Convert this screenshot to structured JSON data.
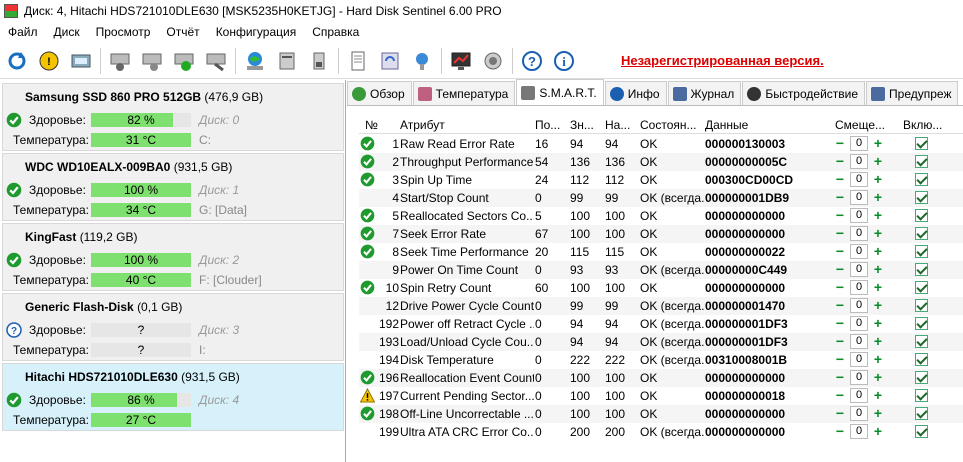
{
  "window": {
    "title": "Диск: 4, Hitachi HDS721010DLE630 [MSK5235H0KETJG]  -  Hard Disk Sentinel 6.00 PRO"
  },
  "menu": [
    "Файл",
    "Диск",
    "Просмотр",
    "Отчёт",
    "Конфигурация",
    "Справка"
  ],
  "toolbar": {
    "unregistered": "Незарегистрированная версия."
  },
  "disks": [
    {
      "name": "Samsung SSD 860 PRO 512GB",
      "size": "(476,9 GB)",
      "health_label": "Здоровье:",
      "health": "82 %",
      "health_pct": 82,
      "disk_label": "Диск: 0",
      "temp_label": "Температура:",
      "temp": "31 °C",
      "drive": "C:",
      "status": "ok"
    },
    {
      "name": "WDC WD10EALX-009BA0",
      "size": "(931,5 GB)",
      "health_label": "Здоровье:",
      "health": "100 %",
      "health_pct": 100,
      "disk_label": "Диск: 1",
      "temp_label": "Температура:",
      "temp": "34 °C",
      "drive": "G: [Data]",
      "status": "ok"
    },
    {
      "name": "KingFast",
      "size": "(119,2 GB)",
      "health_label": "Здоровье:",
      "health": "100 %",
      "health_pct": 100,
      "disk_label": "Диск: 2",
      "temp_label": "Температура:",
      "temp": "40 °C",
      "drive": "F: [Clouder]",
      "status": "ok"
    },
    {
      "name": "Generic Flash-Disk",
      "size": "(0,1 GB)",
      "health_label": "Здоровье:",
      "health": "?",
      "health_pct": 0,
      "disk_label": "Диск: 3",
      "temp_label": "Температура:",
      "temp": "?",
      "drive": "I:",
      "status": "unknown"
    },
    {
      "name": "Hitachi HDS721010DLE630",
      "size": "(931,5 GB)",
      "health_label": "Здоровье:",
      "health": "86 %",
      "health_pct": 86,
      "disk_label": "Диск: 4",
      "temp_label": "Температура:",
      "temp": "27 °C",
      "drive": "",
      "status": "ok"
    }
  ],
  "tabs": [
    "Обзор",
    "Температура",
    "S.M.A.R.T.",
    "Инфо",
    "Журнал",
    "Быстродействие",
    "Предупреж"
  ],
  "smart": {
    "headers": [
      "№",
      "Атрибут",
      "По...",
      "Зн...",
      "На...",
      "Состоян...",
      "Данные",
      "Смеще...",
      "Вклю..."
    ],
    "rows": [
      {
        "st": "ok",
        "n": "1",
        "attr": "Raw Read Error Rate",
        "p": "16",
        "z": "94",
        "na": "94",
        "s": "OK",
        "d": "000000130003",
        "off": "0"
      },
      {
        "st": "ok",
        "n": "2",
        "attr": "Throughput Performance",
        "p": "54",
        "z": "136",
        "na": "136",
        "s": "OK",
        "d": "00000000005C",
        "off": "0"
      },
      {
        "st": "ok",
        "n": "3",
        "attr": "Spin Up Time",
        "p": "24",
        "z": "112",
        "na": "112",
        "s": "OK",
        "d": "000300CD00CD",
        "off": "0"
      },
      {
        "st": "",
        "n": "4",
        "attr": "Start/Stop Count",
        "p": "0",
        "z": "99",
        "na": "99",
        "s": "OK (всегда...",
        "d": "000000001DB9",
        "off": "0"
      },
      {
        "st": "ok",
        "n": "5",
        "attr": "Reallocated Sectors Co...",
        "p": "5",
        "z": "100",
        "na": "100",
        "s": "OK",
        "d": "000000000000",
        "off": "0"
      },
      {
        "st": "ok",
        "n": "7",
        "attr": "Seek Error Rate",
        "p": "67",
        "z": "100",
        "na": "100",
        "s": "OK",
        "d": "000000000000",
        "off": "0"
      },
      {
        "st": "ok",
        "n": "8",
        "attr": "Seek Time Performance",
        "p": "20",
        "z": "115",
        "na": "115",
        "s": "OK",
        "d": "000000000022",
        "off": "0"
      },
      {
        "st": "",
        "n": "9",
        "attr": "Power On Time Count",
        "p": "0",
        "z": "93",
        "na": "93",
        "s": "OK (всегда...",
        "d": "00000000C449",
        "off": "0"
      },
      {
        "st": "ok",
        "n": "10",
        "attr": "Spin Retry Count",
        "p": "60",
        "z": "100",
        "na": "100",
        "s": "OK",
        "d": "000000000000",
        "off": "0"
      },
      {
        "st": "",
        "n": "12",
        "attr": "Drive Power Cycle Count",
        "p": "0",
        "z": "99",
        "na": "99",
        "s": "OK (всегда...",
        "d": "000000001470",
        "off": "0"
      },
      {
        "st": "",
        "n": "192",
        "attr": "Power off Retract Cycle ...",
        "p": "0",
        "z": "94",
        "na": "94",
        "s": "OK (всегда...",
        "d": "000000001DF3",
        "off": "0"
      },
      {
        "st": "",
        "n": "193",
        "attr": "Load/Unload Cycle Cou...",
        "p": "0",
        "z": "94",
        "na": "94",
        "s": "OK (всегда...",
        "d": "000000001DF3",
        "off": "0"
      },
      {
        "st": "",
        "n": "194",
        "attr": "Disk Temperature",
        "p": "0",
        "z": "222",
        "na": "222",
        "s": "OK (всегда...",
        "d": "00310008001B",
        "off": "0"
      },
      {
        "st": "ok",
        "n": "196",
        "attr": "Reallocation Event Count",
        "p": "0",
        "z": "100",
        "na": "100",
        "s": "OK",
        "d": "000000000000",
        "off": "0"
      },
      {
        "st": "warn",
        "n": "197",
        "attr": "Current Pending Sector...",
        "p": "0",
        "z": "100",
        "na": "100",
        "s": "OK",
        "d": "000000000018",
        "off": "0"
      },
      {
        "st": "ok",
        "n": "198",
        "attr": "Off-Line Uncorrectable ...",
        "p": "0",
        "z": "100",
        "na": "100",
        "s": "OK",
        "d": "000000000000",
        "off": "0"
      },
      {
        "st": "",
        "n": "199",
        "attr": "Ultra ATA CRC Error Co...",
        "p": "0",
        "z": "200",
        "na": "200",
        "s": "OK (всегда...",
        "d": "000000000000",
        "off": "0"
      }
    ]
  },
  "colors": {
    "ok_green": "#1f9a2f",
    "health_bar": "#7ee06e",
    "selected_disk": "#d7f1fb",
    "unregistered": "#dd0000"
  }
}
